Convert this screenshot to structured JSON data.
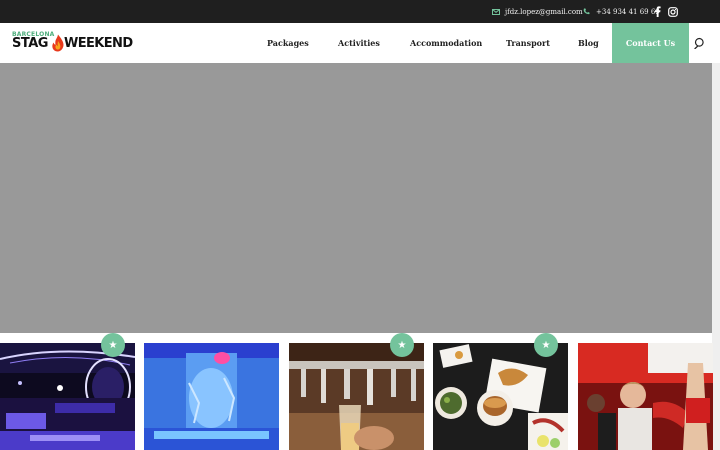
{
  "topbar": {
    "email": "jfdz.lopez@gmail.com",
    "phone": "+34 934 41 69 69",
    "icons": [
      "mail-icon",
      "phone-icon",
      "facebook-icon",
      "instagram-icon"
    ]
  },
  "logo": {
    "city": "BARCELONA",
    "part1": "STAG",
    "part2": "WEEKEND"
  },
  "nav": {
    "items": [
      {
        "label": "Packages"
      },
      {
        "label": "Activities"
      },
      {
        "label": "Accommodation"
      },
      {
        "label": "Transport"
      },
      {
        "label": "Blog"
      }
    ],
    "contact_label": "Contact Us"
  },
  "cards": [
    {
      "image": "nightclub-photo",
      "featured": true
    },
    {
      "image": "ice-bar-photo",
      "featured": false
    },
    {
      "image": "beer-taps-photo",
      "featured": true
    },
    {
      "image": "restaurant-food-photo",
      "featured": true
    },
    {
      "image": "party-show-photo",
      "featured": false
    }
  ],
  "badge_symbol": "★",
  "colors": {
    "accent": "#74c39c",
    "topbar": "#1f1f1f",
    "hero_placeholder": "#999999"
  }
}
